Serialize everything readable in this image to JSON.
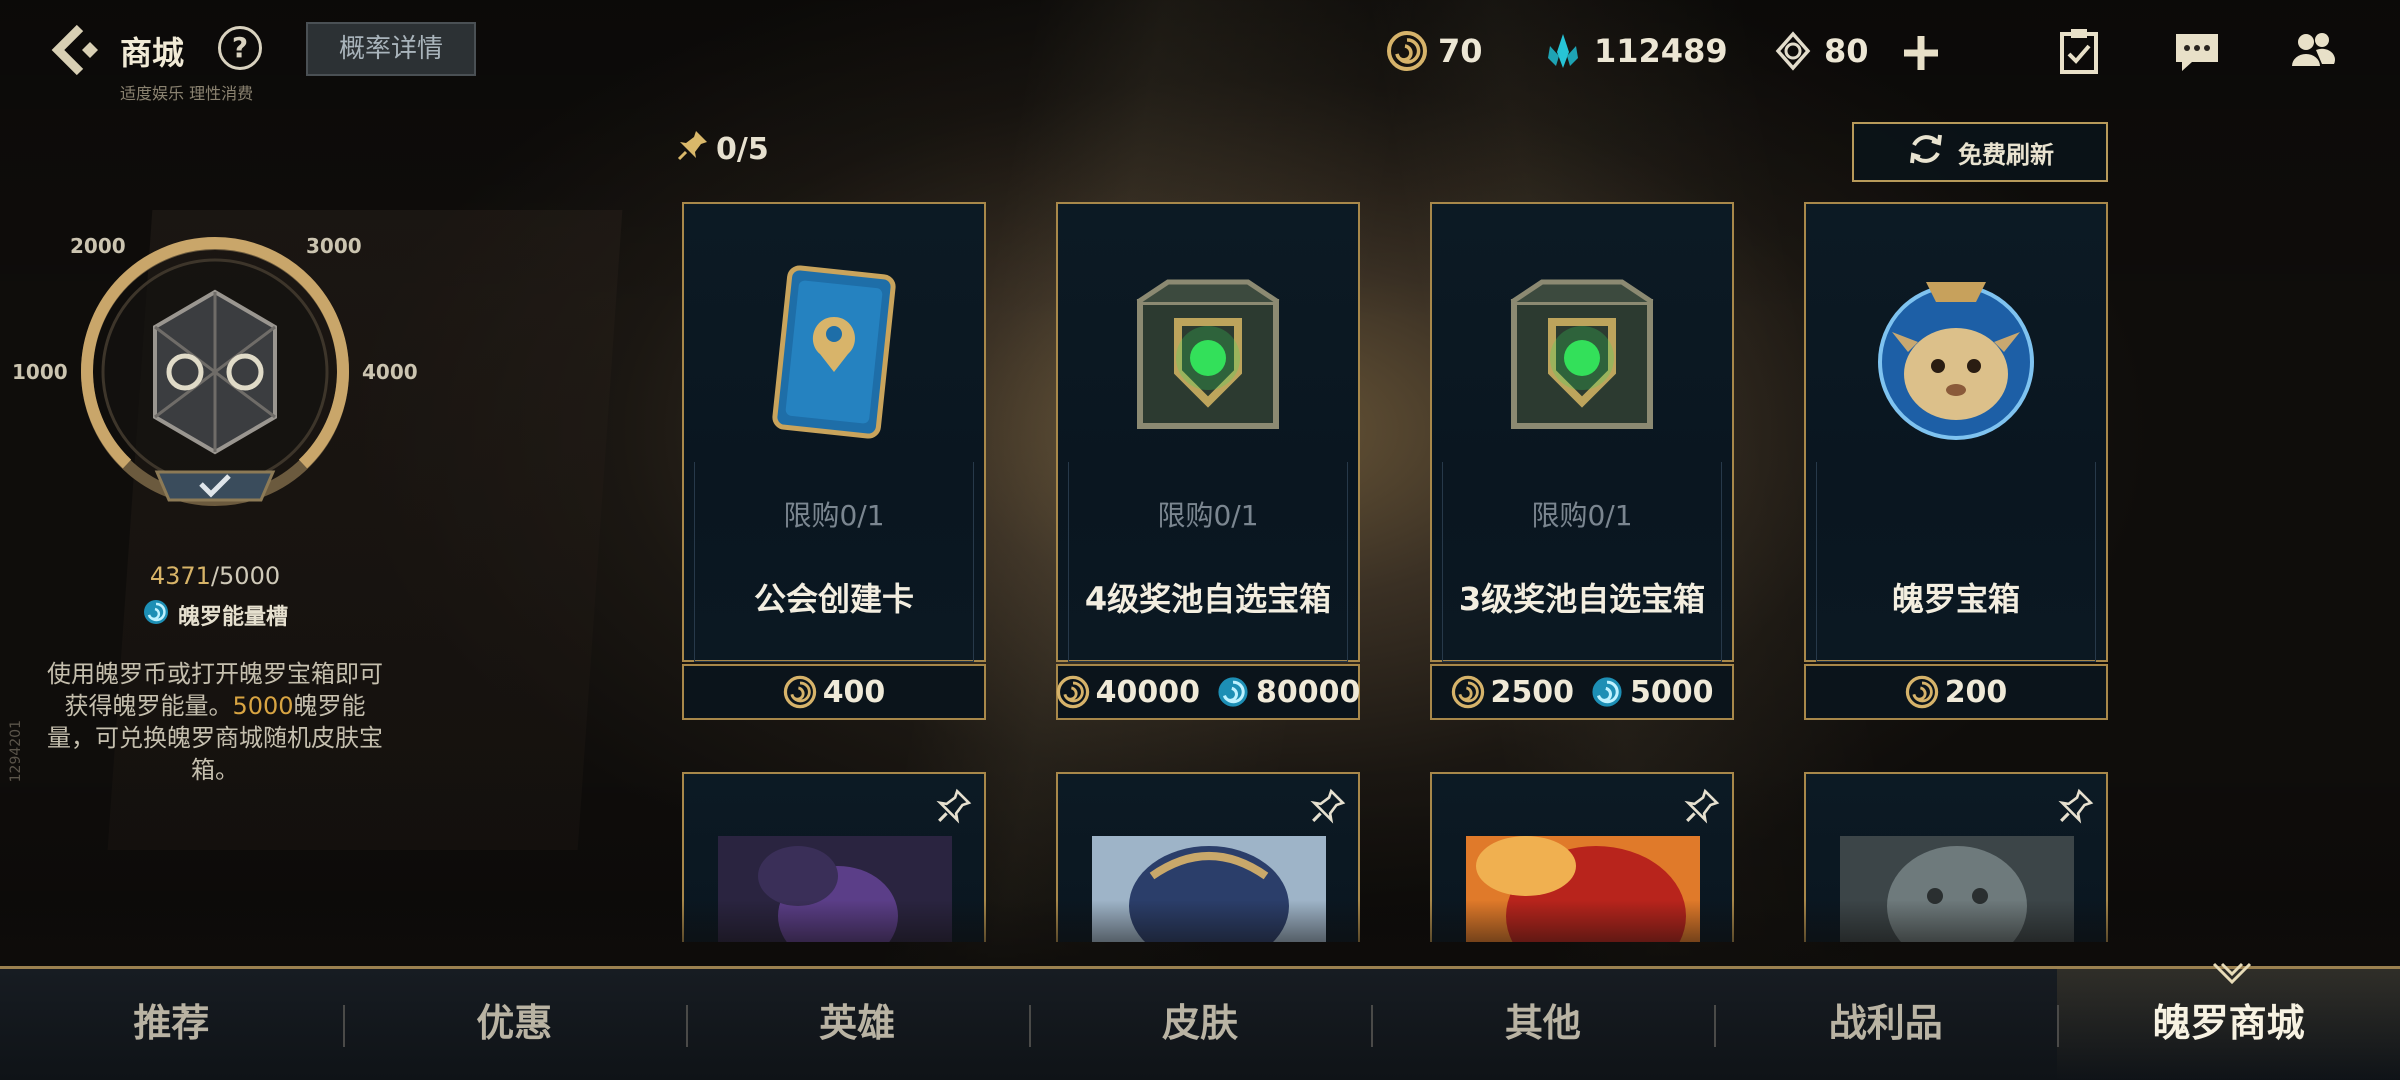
{
  "header": {
    "title": "商城",
    "subtitle": "适度娱乐 理性消费",
    "help_label": "?",
    "probability_button": "概率详情"
  },
  "currencies": [
    {
      "name": "blue-essence",
      "value": "70"
    },
    {
      "name": "crystal",
      "value": "112489"
    },
    {
      "name": "token",
      "value": "80"
    }
  ],
  "energy": {
    "ticks": [
      "2000",
      "3000",
      "1000",
      "4000"
    ],
    "current": "4371",
    "max": "/5000",
    "label": "魄罗能量槽",
    "desc_part1": "使用魄罗币或打开魄罗宝箱即可获得魄罗能量。",
    "desc_highlight": "5000",
    "desc_part2": "魄罗能量，可兑换魄罗商城随机皮肤宝箱。",
    "side_code": "1294201"
  },
  "shop": {
    "pin_count": "0/5",
    "refresh_label": "免费刷新",
    "cards": [
      {
        "limit": "限购0/1",
        "name": "公会创建卡",
        "prices": [
          {
            "icon": "poro-coin",
            "value": "400"
          }
        ]
      },
      {
        "limit": "限购0/1",
        "name": "4级奖池自选宝箱",
        "prices": [
          {
            "icon": "poro-coin",
            "value": "40000"
          },
          {
            "icon": "poro-energy",
            "value": "80000"
          }
        ]
      },
      {
        "limit": "限购0/1",
        "name": "3级奖池自选宝箱",
        "prices": [
          {
            "icon": "poro-coin",
            "value": "2500"
          },
          {
            "icon": "poro-energy",
            "value": "5000"
          }
        ]
      },
      {
        "limit": "",
        "name": "魄罗宝箱",
        "prices": [
          {
            "icon": "poro-coin",
            "value": "200"
          }
        ]
      }
    ]
  },
  "nav": {
    "tabs": [
      "推荐",
      "优惠",
      "英雄",
      "皮肤",
      "其他",
      "战利品",
      "魄罗商城"
    ],
    "active": "魄罗商城"
  },
  "colors": {
    "gold": "#a8884a",
    "highlight": "#d8a442",
    "panel": "#0c1a24"
  }
}
